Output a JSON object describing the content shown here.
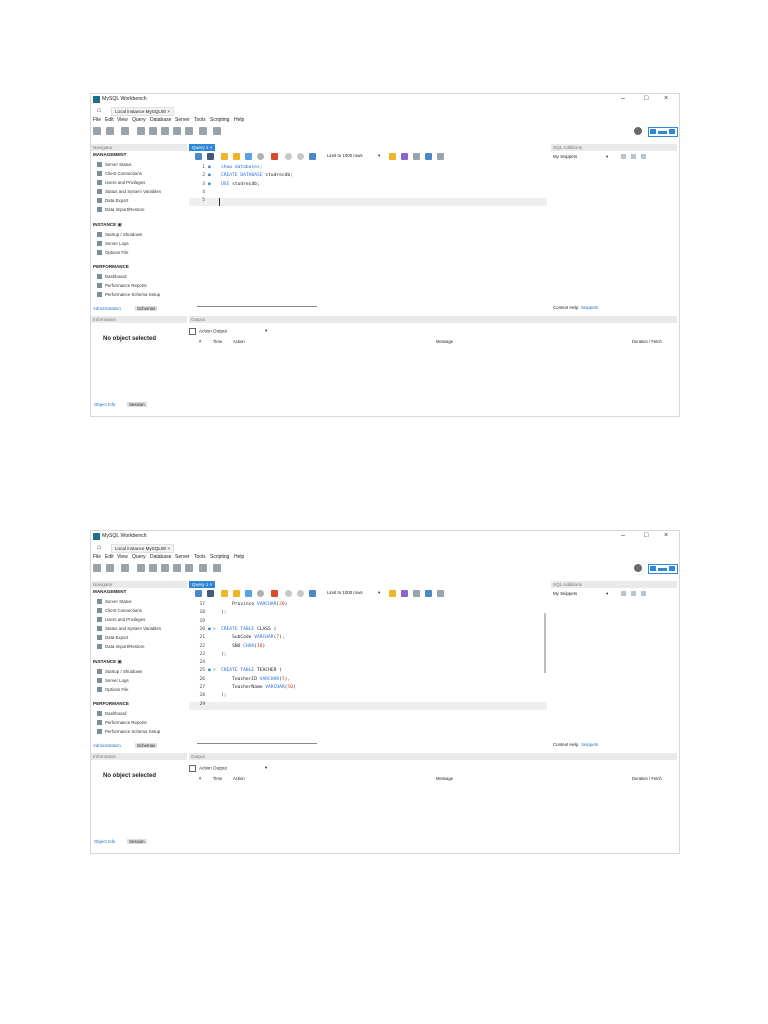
{
  "window": {
    "app_title": "MySQL Workbench",
    "connection_tab": "Local instance MySQL80",
    "minimize": "–",
    "maximize": "□",
    "close": "×"
  },
  "menu": [
    "File",
    "Edit",
    "View",
    "Query",
    "Database",
    "Server",
    "Tools",
    "Scripting",
    "Help"
  ],
  "navigator": {
    "header": "Navigator",
    "management_title": "MANAGEMENT",
    "management_items": [
      "Server Status",
      "Client Connections",
      "Users and Privileges",
      "Status and System Variables",
      "Data Export",
      "Data Import/Restore"
    ],
    "instance_title": "INSTANCE",
    "instance_items": [
      "Startup / Shutdown",
      "Server Logs",
      "Options File"
    ],
    "performance_title": "PERFORMANCE",
    "performance_items": [
      "Dashboard",
      "Performance Reports",
      "Performance Schema Setup"
    ],
    "tabs": [
      "Administration",
      "Schemas"
    ]
  },
  "information": {
    "header": "Information",
    "empty_text": "No object selected",
    "tabs": [
      "Object Info",
      "Session"
    ]
  },
  "query_tab": "Query 1",
  "query_toolbar": {
    "limit_label": "Limit to 1000 rows",
    "caret": "▾"
  },
  "sql_additions": {
    "header": "SQL Additions",
    "snippets_select": "My Snippets",
    "tabs": [
      "Context Help",
      "Snippets"
    ]
  },
  "output": {
    "header": "Output",
    "select": "Action Output",
    "columns": [
      "#",
      "Time",
      "Action",
      "Message",
      "Duration / Fetch"
    ]
  },
  "screenshot1": {
    "lines": [
      {
        "n": "1",
        "dot": "●",
        "fold": "",
        "code": [
          {
            "t": "show databases;",
            "k": "kw"
          }
        ]
      },
      {
        "n": "2",
        "dot": "●",
        "fold": "",
        "code": [
          {
            "t": "CREATE DATABASE ",
            "k": "kw"
          },
          {
            "t": "studrecdb;",
            "k": ""
          }
        ]
      },
      {
        "n": "3",
        "dot": "●",
        "fold": "",
        "code": [
          {
            "t": "USE ",
            "k": "kw"
          },
          {
            "t": "studrecdb;",
            "k": ""
          }
        ]
      },
      {
        "n": "4",
        "dot": "",
        "fold": "",
        "code": []
      },
      {
        "n": "5",
        "dot": "",
        "fold": "",
        "code": []
      }
    ]
  },
  "screenshot2": {
    "lines": [
      {
        "n": "17",
        "dot": "",
        "fold": "",
        "code": [
          {
            "t": "    Province ",
            "k": ""
          },
          {
            "t": "VARCHAR",
            "k": "kw"
          },
          {
            "t": "(",
            "k": ""
          },
          {
            "t": "20",
            "k": "num"
          },
          {
            "t": ")",
            "k": ""
          }
        ]
      },
      {
        "n": "18",
        "dot": "",
        "fold": "",
        "code": [
          {
            "t": ");",
            "k": ""
          }
        ]
      },
      {
        "n": "19",
        "dot": "",
        "fold": "",
        "code": []
      },
      {
        "n": "20",
        "dot": "●",
        "fold": "⊖",
        "code": [
          {
            "t": "CREATE TABLE ",
            "k": "kw"
          },
          {
            "t": "CLASS (",
            "k": ""
          }
        ]
      },
      {
        "n": "21",
        "dot": "",
        "fold": "",
        "code": [
          {
            "t": "    SubCode ",
            "k": ""
          },
          {
            "t": "VARCHAR",
            "k": "kw"
          },
          {
            "t": "(",
            "k": ""
          },
          {
            "t": "7",
            "k": "num"
          },
          {
            "t": "),",
            "k": ""
          }
        ]
      },
      {
        "n": "22",
        "dot": "",
        "fold": "",
        "code": [
          {
            "t": "    SNO ",
            "k": ""
          },
          {
            "t": "CHAR",
            "k": "kw"
          },
          {
            "t": "(",
            "k": ""
          },
          {
            "t": "10",
            "k": "num"
          },
          {
            "t": ")",
            "k": ""
          }
        ]
      },
      {
        "n": "23",
        "dot": "",
        "fold": "",
        "code": [
          {
            "t": ");",
            "k": ""
          }
        ]
      },
      {
        "n": "24",
        "dot": "",
        "fold": "",
        "code": []
      },
      {
        "n": "25",
        "dot": "●",
        "fold": "⊖",
        "code": [
          {
            "t": "CREATE TABLE ",
            "k": "kw"
          },
          {
            "t": "TEACHER (",
            "k": ""
          }
        ]
      },
      {
        "n": "26",
        "dot": "",
        "fold": "",
        "code": [
          {
            "t": "    TeacherID ",
            "k": ""
          },
          {
            "t": "VARCHAR",
            "k": "kw"
          },
          {
            "t": "(",
            "k": ""
          },
          {
            "t": "5",
            "k": "num"
          },
          {
            "t": "),",
            "k": ""
          }
        ]
      },
      {
        "n": "27",
        "dot": "",
        "fold": "",
        "code": [
          {
            "t": "    TeacherName ",
            "k": ""
          },
          {
            "t": "VARCHAR",
            "k": "kw"
          },
          {
            "t": "(",
            "k": ""
          },
          {
            "t": "50",
            "k": "num"
          },
          {
            "t": ")",
            "k": ""
          }
        ]
      },
      {
        "n": "28",
        "dot": "",
        "fold": "",
        "code": [
          {
            "t": ");",
            "k": ""
          }
        ]
      },
      {
        "n": "29",
        "dot": "",
        "fold": "",
        "code": []
      }
    ]
  }
}
